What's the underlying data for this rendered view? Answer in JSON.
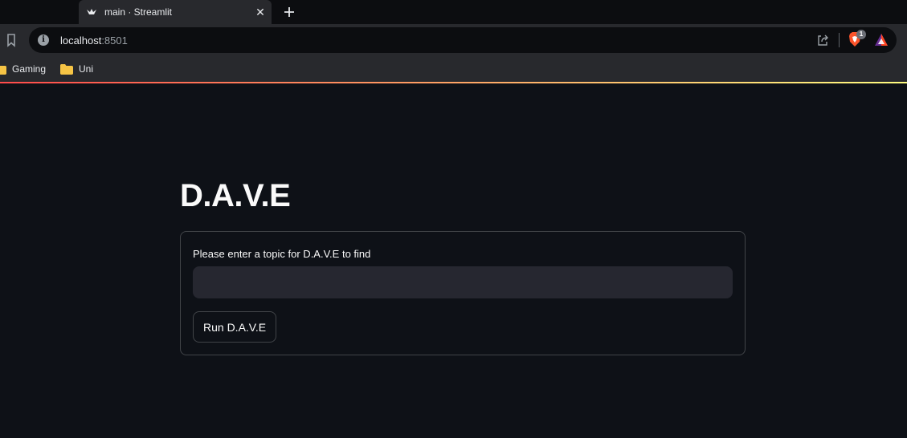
{
  "browser": {
    "tab": {
      "title": "main · Streamlit",
      "favicon": "streamlit-crown-icon",
      "close_icon": "close-icon"
    },
    "new_tab_icon": "plus-icon",
    "toolbar": {
      "bookmark_icon": "bookmark-icon",
      "site_info_icon": "info-icon",
      "site_info_glyph": "i",
      "url_host": "localhost",
      "url_port": ":8501",
      "share_icon": "share-icon",
      "brave_shield_icon": "brave-shield-icon",
      "brave_shield_count": "1",
      "brave_rewards_icon": "brave-rewards-icon"
    },
    "bookmarks": [
      {
        "label": "Gaming",
        "icon": "folder-icon"
      },
      {
        "label": "Uni",
        "icon": "folder-icon"
      }
    ]
  },
  "app": {
    "title": "D.A.V.E",
    "form": {
      "input_label": "Please enter a topic for D.A.V.E to find",
      "input_value": "",
      "input_placeholder": "",
      "submit_label": "Run D.A.V.E"
    }
  },
  "colors": {
    "background": "#0e1117",
    "browser_chrome": "#28292d",
    "input_background": "#262730",
    "decoration_start": "#ff4b4b",
    "decoration_end": "#fffd80",
    "folder": "#f6c445"
  }
}
